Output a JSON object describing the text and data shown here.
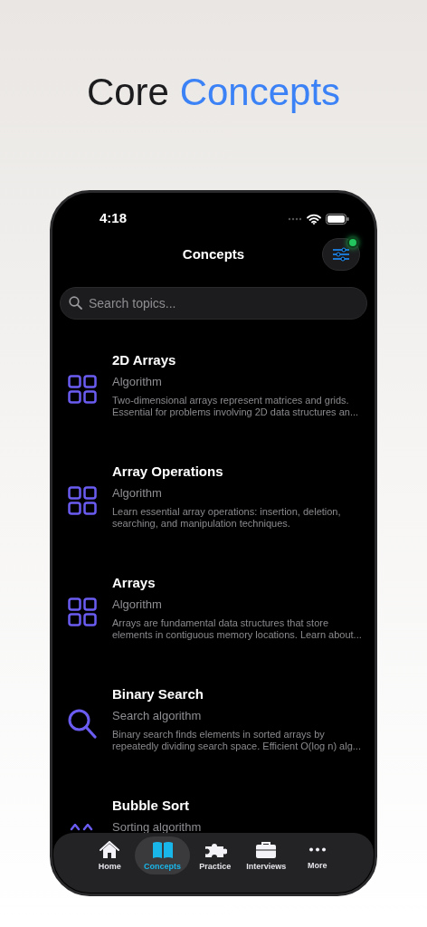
{
  "headline": {
    "lead": "Core",
    "accent": "Concepts"
  },
  "status_bar": {
    "time": "4:18"
  },
  "header": {
    "title": "Concepts",
    "filter_active": true
  },
  "search": {
    "placeholder": "Search topics..."
  },
  "topics": [
    {
      "title": "2D Arrays",
      "category": "Algorithm",
      "description": "Two-dimensional arrays represent matrices and grids. Essential for problems involving 2D data structures an...",
      "kind": "grid"
    },
    {
      "title": "Array Operations",
      "category": "Algorithm",
      "description": "Learn essential array operations: insertion, deletion, searching, and manipulation techniques.",
      "kind": "grid"
    },
    {
      "title": "Arrays",
      "category": "Algorithm",
      "description": "Arrays are fundamental data structures that store elements in contiguous memory locations. Learn about...",
      "kind": "grid"
    },
    {
      "title": "Binary Search",
      "category": "Search algorithm",
      "description": "Binary search finds elements in sorted arrays by repeatedly dividing search space. Efficient O(log n) alg...",
      "kind": "search"
    },
    {
      "title": "Bubble Sort",
      "category": "Sorting algorithm",
      "kind": "sort"
    }
  ],
  "tabs": [
    {
      "label": "Home",
      "kind": "home",
      "selected": false
    },
    {
      "label": "Concepts",
      "kind": "book",
      "selected": true
    },
    {
      "label": "Practice",
      "kind": "puzzle",
      "selected": false
    },
    {
      "label": "Interviews",
      "kind": "briefcase",
      "selected": false
    },
    {
      "label": "More",
      "kind": "more",
      "selected": false
    }
  ]
}
